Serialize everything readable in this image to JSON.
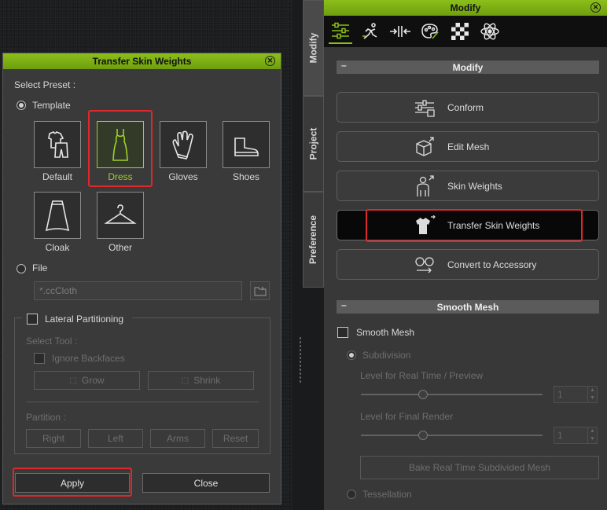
{
  "dialog": {
    "title": "Transfer Skin Weights",
    "select_preset_label": "Select Preset :",
    "template_label": "Template",
    "presets": [
      {
        "name": "Default",
        "icon": "shirt-pants-icon"
      },
      {
        "name": "Dress",
        "icon": "dress-icon",
        "selected": true
      },
      {
        "name": "Gloves",
        "icon": "glove-icon"
      },
      {
        "name": "Shoes",
        "icon": "boot-icon"
      },
      {
        "name": "Cloak",
        "icon": "cloak-icon"
      },
      {
        "name": "Other",
        "icon": "hanger-icon"
      }
    ],
    "file_label": "File",
    "file_placeholder": "*.ccCloth",
    "lateral_partitioning_label": "Lateral Partitioning",
    "select_tool_label": "Select Tool :",
    "ignore_backfaces_label": "Ignore Backfaces",
    "grow_label": "Grow",
    "shrink_label": "Shrink",
    "partition_label": "Partition :",
    "partition_buttons": [
      "Right",
      "Left",
      "Arms",
      "Reset"
    ],
    "apply_label": "Apply",
    "close_label": "Close"
  },
  "side_tabs": [
    "Modify",
    "Project",
    "Preference"
  ],
  "panel": {
    "title": "Modify",
    "modify_section": "Modify",
    "buttons": [
      "Conform",
      "Edit Mesh",
      "Skin Weights",
      "Transfer Skin Weights",
      "Convert to Accessory"
    ],
    "smooth_section": "Smooth Mesh",
    "smooth_mesh_label": "Smooth Mesh",
    "subdivision_label": "Subdivision",
    "level_realtime_label": "Level for Real Time / Preview",
    "level_realtime_value": "1",
    "level_final_label": "Level for Final Render",
    "level_final_value": "1",
    "bake_label": "Bake Real Time Subdivided Mesh",
    "tessellation_label": "Tessellation"
  },
  "colors": {
    "accent": "#8bbf1a",
    "highlight": "#e0272b",
    "selected": "#9ed02a"
  }
}
